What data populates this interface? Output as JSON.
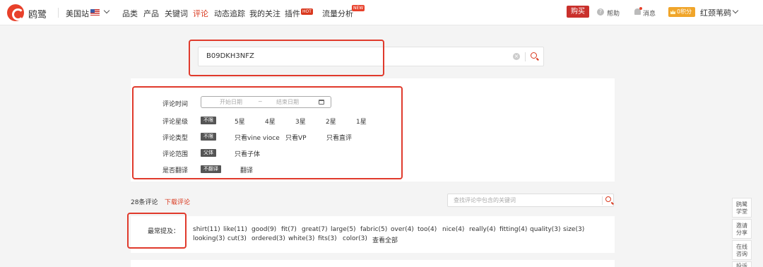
{
  "header": {
    "brand": "鸥鹭",
    "site": "美国站",
    "nav": [
      "品类",
      "产品",
      "关键词",
      "评论",
      "动态追踪",
      "我的关注",
      "插件",
      "流量分析"
    ],
    "nav_active_index": 3,
    "plugin_tag": "HOT",
    "traffic_tag": "NEW",
    "buy_label": "购买",
    "help_label": "帮助",
    "messages_label": "消息",
    "points_label": "0积分",
    "username": "红颈苇鹀"
  },
  "search": {
    "value": "B09DKH3NFZ"
  },
  "filters": {
    "time_label": "评论时间",
    "start_placeholder": "开始日期",
    "range_sep": "~",
    "end_placeholder": "结束日期",
    "star_label": "评论星级",
    "star_options": [
      "不限",
      "5星",
      "4星",
      "3星",
      "2星",
      "1星"
    ],
    "type_label": "评论类型",
    "type_options": [
      "不限",
      "只看vine vioce",
      "只看VP",
      "只看直评"
    ],
    "scope_label": "评论范围",
    "scope_options": [
      "父体",
      "只看子体"
    ],
    "translate_label": "是否翻译",
    "translate_options": [
      "不翻译",
      "翻译"
    ]
  },
  "reviews": {
    "count_text": "28条评论",
    "download_label": "下载评论",
    "keyword_placeholder": "查找评论中包含的关键词"
  },
  "mentions": {
    "label": "最常提及：",
    "row1": [
      "shirt(11)",
      "like(11)",
      "good(9)",
      "fit(7)",
      "great(7)",
      "large(5)",
      "fabric(5)",
      "over(4)",
      "too(4)",
      "nice(4)",
      "really(4)",
      "fitting(4)",
      "quality(3)",
      "size(3)"
    ],
    "row2": [
      "looking(3)",
      "cut(3)",
      "ordered(3)",
      "white(3)",
      "fits(3)",
      "color(3)"
    ],
    "view_all": "查看全部"
  },
  "float": {
    "items": [
      [
        "鸥鹭",
        "学堂"
      ],
      [
        "邀请",
        "分享"
      ],
      [
        "在线",
        "咨询"
      ],
      [
        "投诉"
      ]
    ]
  },
  "colors": {
    "accent": "#d9381e",
    "annotation": "#e03a2c",
    "points": "#f0a52a"
  }
}
